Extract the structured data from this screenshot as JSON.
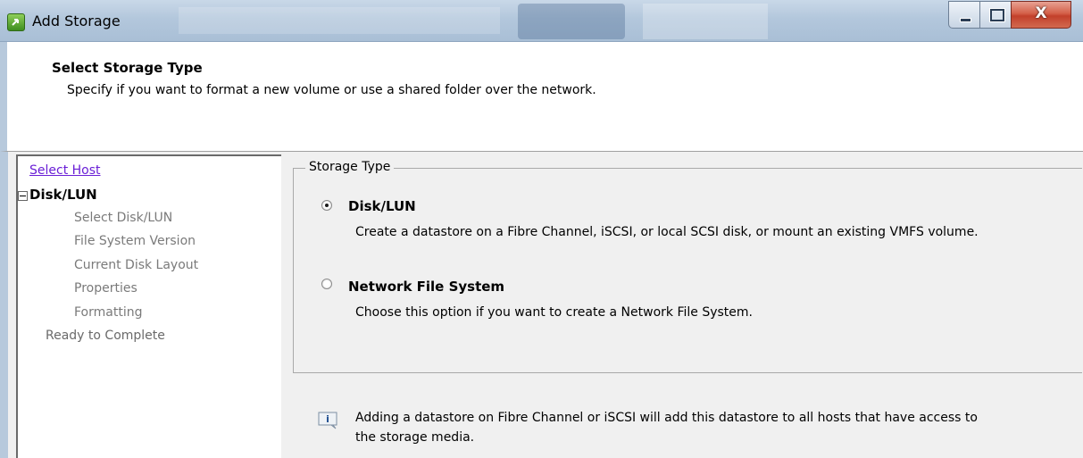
{
  "window": {
    "title": "Add Storage",
    "close_glyph": "X",
    "accent_color": "#b7c9dc"
  },
  "header": {
    "title": "Select Storage Type",
    "subtitle": "Specify if you want to format a new volume or use a shared folder over the network."
  },
  "nav": {
    "select_host": "Select Host",
    "disk_lun": "Disk/LUN",
    "select_disk": "Select Disk/LUN",
    "fs_version": "File System Version",
    "disk_layout": "Current Disk Layout",
    "properties": "Properties",
    "formatting": "Formatting",
    "ready": "Ready to Complete"
  },
  "storage_type": {
    "legend": "Storage Type",
    "options": [
      {
        "title": "Disk/LUN",
        "description": "Create a datastore on a Fibre Channel, iSCSI, or local SCSI disk, or mount an existing VMFS volume.",
        "selected": true
      },
      {
        "title": "Network File System",
        "description": "Choose this option if you want to create a Network File System.",
        "selected": false
      }
    ]
  },
  "info": {
    "icon": "info-note-icon",
    "text": "Adding a datastore on Fibre Channel or iSCSI will add this datastore to all hosts that have access to the storage media."
  }
}
